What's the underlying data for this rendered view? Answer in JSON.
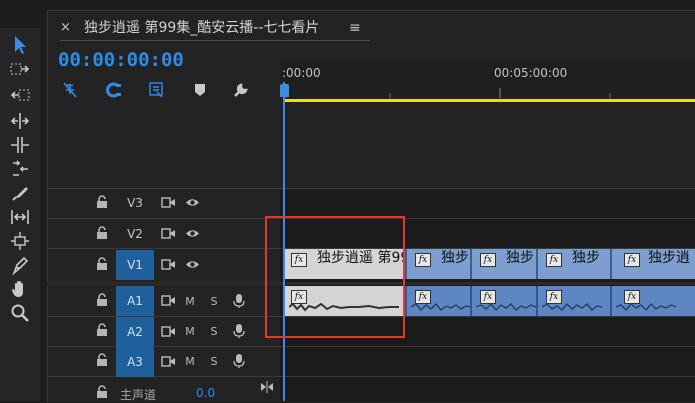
{
  "sequence_tab": {
    "close_glyph": "×",
    "title": "独步逍遥 第99集_酷安云播--七七看片",
    "menu_glyph": "≡"
  },
  "timecode": "00:00:00:00",
  "ruler": {
    "labels": [
      ":00:00",
      "00:05:00:00"
    ]
  },
  "tools": [
    "selection-tool",
    "track-select-forward-tool",
    "track-select-backward-tool",
    "ripple-edit-tool",
    "rolling-edit-tool",
    "rate-stretch-tool",
    "razor-tool",
    "slip-tool",
    "slide-tool",
    "pen-tool",
    "hand-tool",
    "zoom-tool"
  ],
  "controls": [
    "snap-in-timeline",
    "linked-selection",
    "add-marker",
    "marker",
    "timeline-settings-wrench"
  ],
  "tracks": {
    "video": [
      {
        "name": "V3",
        "active": false
      },
      {
        "name": "V2",
        "active": false
      },
      {
        "name": "V1",
        "active": true
      }
    ],
    "audio": [
      {
        "name": "A1",
        "active": true,
        "m": "M",
        "s": "S"
      },
      {
        "name": "A2",
        "active": true,
        "m": "M",
        "s": "S"
      },
      {
        "name": "A3",
        "active": true,
        "m": "M",
        "s": "S"
      }
    ],
    "master": {
      "label": "主声道",
      "value": "0.0"
    }
  },
  "clips": {
    "video": [
      {
        "label": "独步逍遥 第99"
      },
      {
        "label": "独步"
      },
      {
        "label": "独步"
      },
      {
        "label": "独步"
      },
      {
        "label": "独步逍"
      }
    ],
    "fx": "fx"
  },
  "colors": {
    "accent": "#2d8ceb",
    "workarea": "#e9df1d",
    "highlight": "#e5372f",
    "video_clip": "#7d9fd0",
    "audio_clip": "#5d86c3"
  }
}
